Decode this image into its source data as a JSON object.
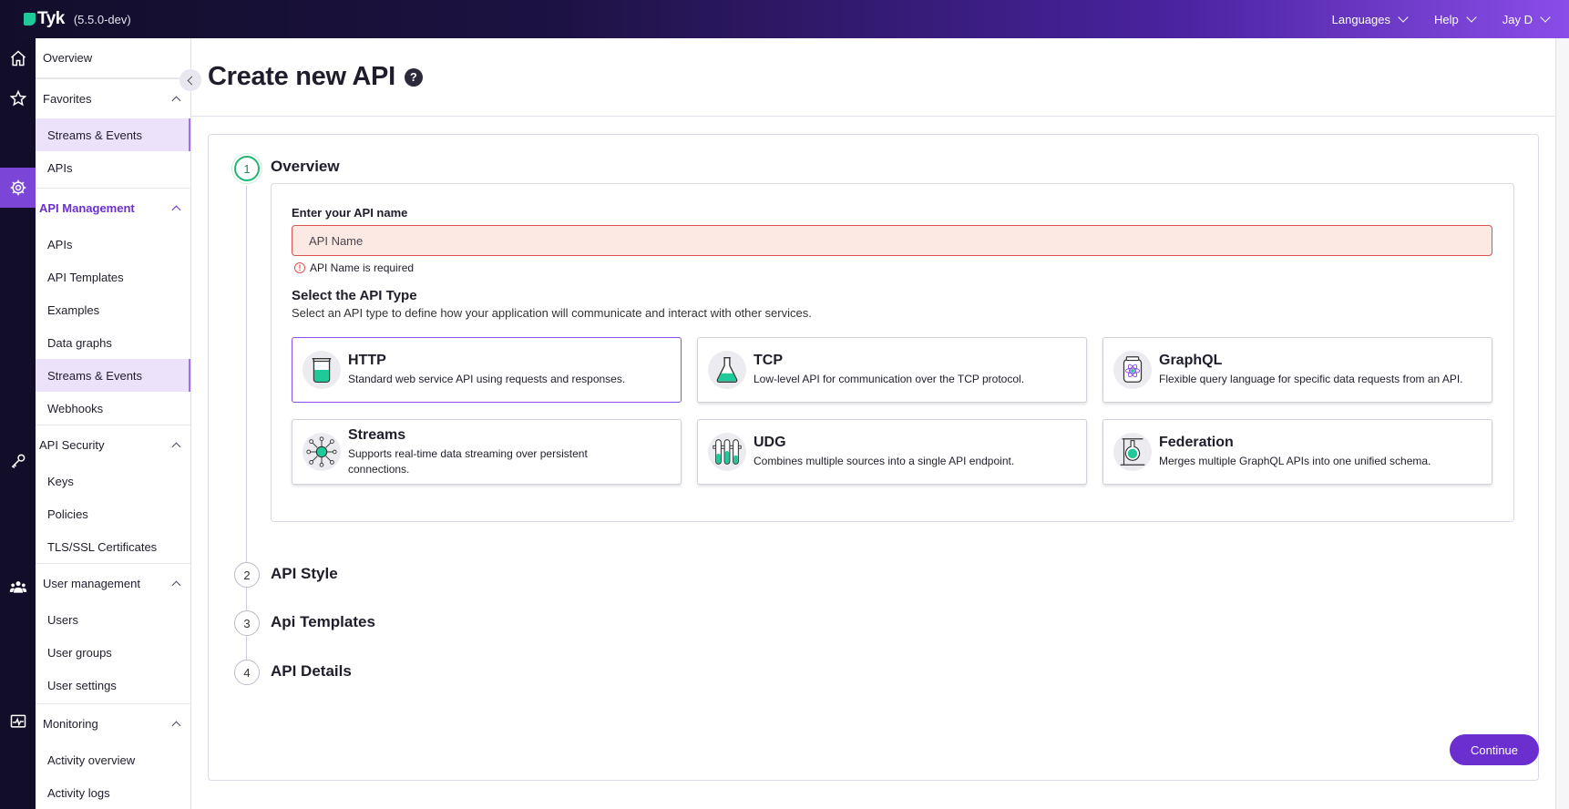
{
  "app": {
    "brand": "Tyk",
    "version": "(5.5.0-dev)"
  },
  "topnav": {
    "languages": "Languages",
    "help": "Help",
    "user": "Jay D"
  },
  "sidebar": {
    "overview": "Overview",
    "favorites": {
      "title": "Favorites",
      "items": [
        "Streams & Events",
        "APIs"
      ]
    },
    "api_management": {
      "title": "API Management",
      "items": [
        "APIs",
        "API Templates",
        "Examples",
        "Data graphs",
        "Streams & Events",
        "Webhooks"
      ]
    },
    "api_security": {
      "title": "API Security",
      "items": [
        "Keys",
        "Policies",
        "TLS/SSL Certificates"
      ]
    },
    "user_management": {
      "title": "User management",
      "items": [
        "Users",
        "User groups",
        "User settings"
      ]
    },
    "monitoring": {
      "title": "Monitoring",
      "items": [
        "Activity overview",
        "Activity logs"
      ]
    }
  },
  "page": {
    "title": "Create new API",
    "help": "?"
  },
  "wizard": {
    "steps": [
      {
        "num": "1",
        "title": "Overview"
      },
      {
        "num": "2",
        "title": "API Style"
      },
      {
        "num": "3",
        "title": "Api Templates"
      },
      {
        "num": "4",
        "title": "API Details"
      }
    ],
    "overview": {
      "name_label": "Enter your API name",
      "name_placeholder": "API Name",
      "name_value": "",
      "error": "API Name is required",
      "type_title": "Select the API Type",
      "type_subtitle": "Select an API type to define how your application will communicate and interact with other services.",
      "types": [
        {
          "title": "HTTP",
          "desc": "Standard web service API using requests and responses."
        },
        {
          "title": "TCP",
          "desc": "Low-level API for communication over the TCP protocol."
        },
        {
          "title": "GraphQL",
          "desc": "Flexible query language for specific data requests from an API."
        },
        {
          "title": "Streams",
          "desc": "Supports real-time data streaming over persistent connections."
        },
        {
          "title": "UDG",
          "desc": "Combines multiple sources into a single API endpoint."
        },
        {
          "title": "Federation",
          "desc": "Merges multiple GraphQL APIs into one unified schema."
        }
      ]
    },
    "continue": "Continue"
  },
  "colors": {
    "accent": "#6b2fd0",
    "teal": "#20c99a",
    "error": "#d9534f",
    "step_active": "#22b573"
  }
}
